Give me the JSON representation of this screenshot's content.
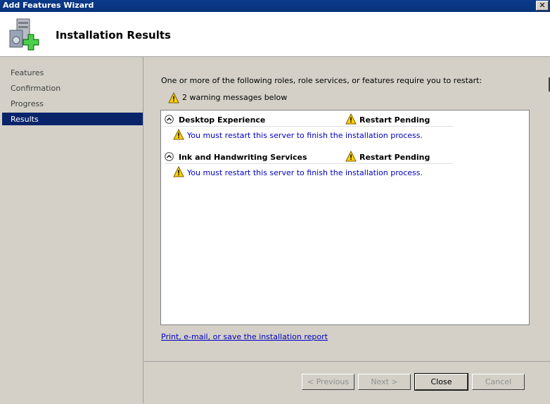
{
  "window": {
    "title": "Add Features Wizard",
    "close_glyph": "✕"
  },
  "header": {
    "title": "Installation Results",
    "icon": "server-add-icon"
  },
  "sidebar": {
    "items": [
      {
        "label": "Features",
        "active": false
      },
      {
        "label": "Confirmation",
        "active": false
      },
      {
        "label": "Progress",
        "active": false
      },
      {
        "label": "Results",
        "active": true
      }
    ]
  },
  "main": {
    "intro": "One or more of the following roles, role services, or features require you to restart:",
    "warning_summary": "2 warning messages below",
    "results": [
      {
        "feature": "Desktop Experience",
        "status": "Restart Pending",
        "message": "You must restart this server to finish the installation process."
      },
      {
        "feature": "Ink and Handwriting Services",
        "status": "Restart Pending",
        "message": "You must restart this server to finish the installation process."
      }
    ],
    "report_link": "Print, e-mail, or save the installation report"
  },
  "buttons": {
    "previous": "< Previous",
    "next": "Next >",
    "close": "Close",
    "cancel": "Cancel"
  },
  "colors": {
    "titlebar": "#0a246a",
    "link": "#0000c0",
    "selection": "#0a246a"
  }
}
